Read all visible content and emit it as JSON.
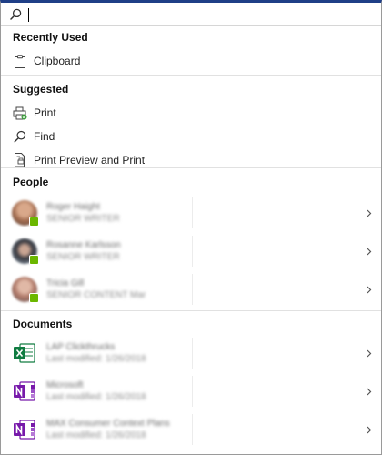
{
  "search": {
    "value": "",
    "placeholder": ""
  },
  "recently_used": {
    "title": "Recently Used",
    "items": [
      {
        "label": "Clipboard",
        "icon": "clipboard-icon"
      }
    ]
  },
  "suggested": {
    "title": "Suggested",
    "items": [
      {
        "label": "Print",
        "icon": "print-icon"
      },
      {
        "label": "Find",
        "icon": "search-icon"
      },
      {
        "label": "Print Preview and Print",
        "icon": "print-preview-icon"
      }
    ]
  },
  "people": {
    "title": "People",
    "items": [
      {
        "name": "Roger Haight",
        "role": "SENIOR WRITER",
        "avatar": "avatar-icon"
      },
      {
        "name": "Rosanne Karlsson",
        "role": "SENIOR WRITER",
        "avatar": "avatar-icon"
      },
      {
        "name": "Tricia Gill",
        "role": "SENIOR CONTENT Mar",
        "avatar": "avatar-icon"
      }
    ]
  },
  "documents": {
    "title": "Documents",
    "items": [
      {
        "name": "LAP Clickthrucks",
        "modified": "Last modified: 1/26/2018",
        "icon": "excel-icon"
      },
      {
        "name": "Microsoft",
        "modified": "Last modified: 1/26/2018",
        "icon": "onenote-icon"
      },
      {
        "name": "MAX Consumer Context Plans",
        "modified": "Last modified: 1/26/2018",
        "icon": "onenote-icon"
      }
    ]
  },
  "colors": {
    "presence": "#6bb700",
    "excel": "#107c41",
    "onenote": "#7719aa",
    "accent_top": "#1f3f87"
  }
}
